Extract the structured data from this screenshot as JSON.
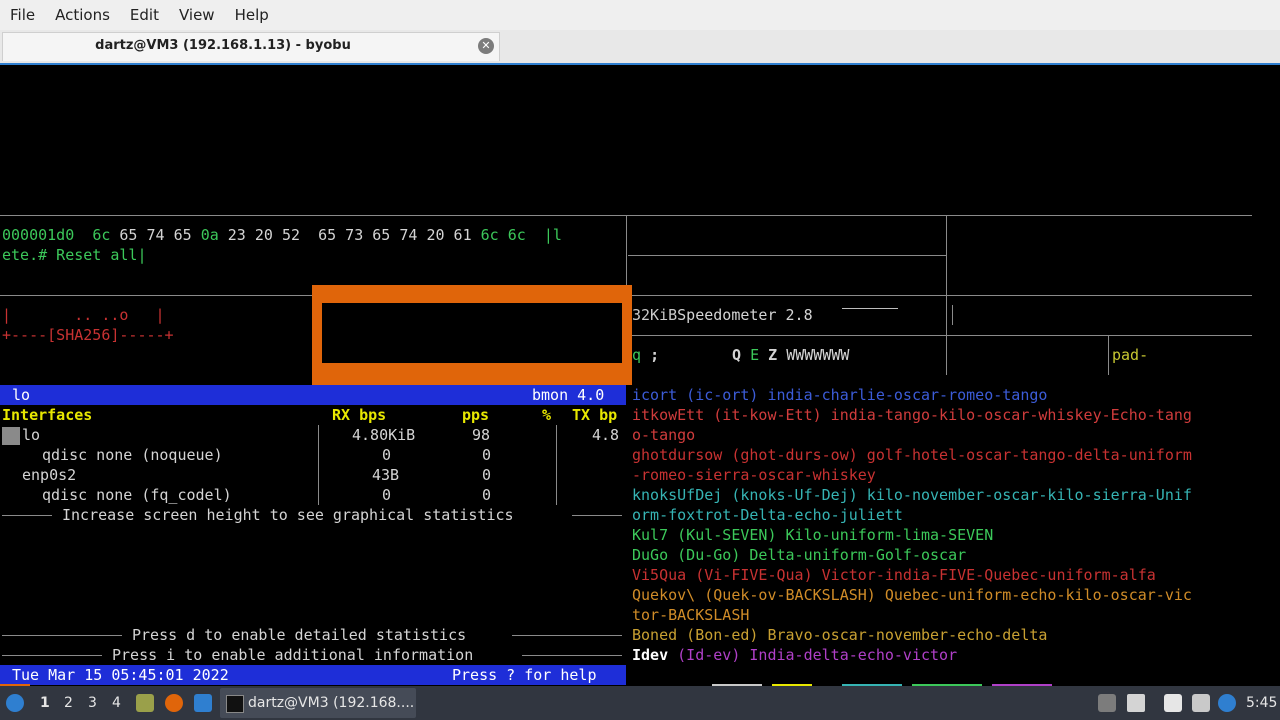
{
  "menubar": {
    "items": [
      "File",
      "Actions",
      "Edit",
      "View",
      "Help"
    ]
  },
  "tab": {
    "title": "dartz@VM3 (192.168.1.13) - byobu",
    "close_glyph": "✕"
  },
  "hexdump": {
    "line1": {
      "addr": "000001d0",
      "b1": "6c",
      "b2": "65 74 65",
      "b3": "0a",
      "b4": "23 20 52  65 73 65 74 20 61",
      "b5": "6c 6c",
      "ascii": "|l"
    },
    "line2": "ete.# Reset all|"
  },
  "sha": {
    "line1": "|       .. ..o   |",
    "line2": "+----[SHA256]-----+"
  },
  "speedo": {
    "size": "32KiB",
    "title": "Speedometer 2.8",
    "row_q": "q",
    "row_semi": ";",
    "row_Q": "Q",
    "row_E": "E",
    "row_Z": "Z",
    "row_W": "WWWWWWW",
    "pad": "pad-"
  },
  "bmon": {
    "iface": "lo",
    "version": "bmon 4.0",
    "headers": {
      "interfaces": "Interfaces",
      "rx_bps": "RX bps",
      "pps": "pps",
      "pct": "%",
      "tx_bp": "TX bp"
    },
    "rows": [
      {
        "name": "lo",
        "rx": "4.80KiB",
        "pps": "98",
        "tx": "4.8"
      },
      {
        "name": "qdisc none (noqueue)",
        "rx": "0",
        "pps": "0",
        "tx": ""
      },
      {
        "name": "enp0s2",
        "rx": "43B",
        "pps": "0",
        "tx": ""
      },
      {
        "name": "qdisc none (fq_codel)",
        "rx": "0",
        "pps": "0",
        "tx": ""
      }
    ],
    "msg_height": "Increase screen height to see graphical statistics",
    "msg_detail": "Press d to enable detailed statistics",
    "msg_info": "Press i to enable additional information",
    "datetime": "Tue Mar 15 05:45:01 2022",
    "help": "Press ? for help"
  },
  "phonetic": [
    {
      "text": "icort (ic-ort) india-charlie-oscar-romeo-tango",
      "color": "#3c5cd8"
    },
    {
      "text": "itkowEtt (it-kow-Ett) india-tango-kilo-oscar-whiskey-Echo-tang",
      "color": "#d03c3c"
    },
    {
      "text": "o-tango",
      "color": "#d03c3c"
    },
    {
      "text": "ghotdursow (ghot-durs-ow) golf-hotel-oscar-tango-delta-uniform",
      "color": "#c83232"
    },
    {
      "text": "-romeo-sierra-oscar-whiskey",
      "color": "#c83232"
    },
    {
      "text": "knoksUfDej (knoks-Uf-Dej) kilo-november-oscar-kilo-sierra-Unif",
      "color": "#36b4b4"
    },
    {
      "text": "orm-foxtrot-Delta-echo-juliett",
      "color": "#36b4b4"
    },
    {
      "text": "Kul7 (Kul-SEVEN) Kilo-uniform-lima-SEVEN",
      "color": "#3cc85a"
    },
    {
      "text": "DuGo (Du-Go) Delta-uniform-Golf-oscar",
      "color": "#3cc85a"
    },
    {
      "text": "Vi5Qua (Vi-FIVE-Qua) Victor-india-FIVE-Quebec-uniform-alfa",
      "color": "#c83232"
    },
    {
      "text": "Quekov\\ (Quek-ov-BACKSLASH) Quebec-uniform-echo-kilo-oscar-vic",
      "color": "#d08c28"
    },
    {
      "text": "tor-BACKSLASH",
      "color": "#d08c28"
    },
    {
      "text": "Boned (Bon-ed) Bravo-oscar-november-echo-delta",
      "color": "#c8a032"
    }
  ],
  "idev": {
    "word": "Idev",
    "rest": " (Id-ev) India-delta-echo-victor"
  },
  "taskbar": {
    "workspaces": [
      "1",
      "2",
      "3",
      "4"
    ],
    "window_title": "dartz@VM3 (192.168....",
    "clock": "5:45"
  },
  "colors": {
    "orange_box": "#e0650a",
    "bmon_bar": "#1e2ed8",
    "status_bar": "#1e2ed8",
    "selection_blue": "#2f7fd0"
  }
}
